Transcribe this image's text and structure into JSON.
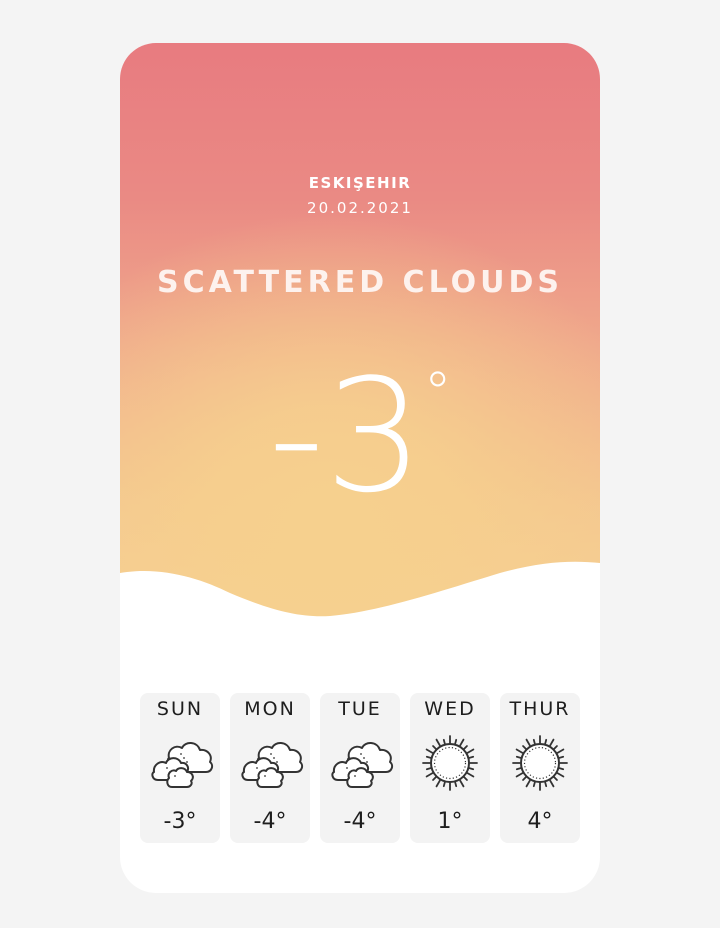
{
  "location": {
    "city": "ESKIŞEHIR",
    "date": "20.02.2021"
  },
  "current": {
    "condition": "SCATTERED CLOUDS",
    "temperature": "-3",
    "degree_symbol": "°"
  },
  "colors": {
    "gradient_top": "#e87b80",
    "gradient_bottom": "#f6d596",
    "text": "#ffffff",
    "tile": "#f3f3f3"
  },
  "forecast": [
    {
      "day": "SUN",
      "temp": "-3°",
      "icon": "clouds-icon"
    },
    {
      "day": "MON",
      "temp": "-4°",
      "icon": "clouds-icon"
    },
    {
      "day": "TUE",
      "temp": "-4°",
      "icon": "clouds-icon"
    },
    {
      "day": "WED",
      "temp": "1°",
      "icon": "sun-icon"
    },
    {
      "day": "THUR",
      "temp": "4°",
      "icon": "sun-icon"
    }
  ]
}
